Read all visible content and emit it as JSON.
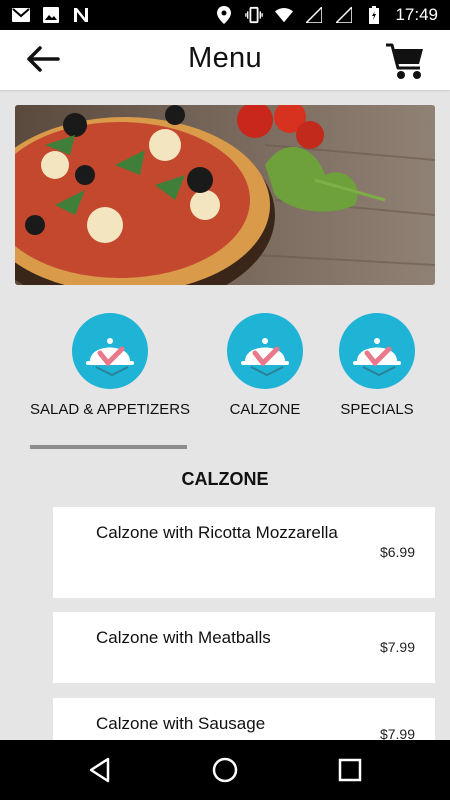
{
  "status_bar": {
    "time": "17:49",
    "icons": [
      "gmail-icon",
      "image-icon",
      "n-icon",
      "location-icon",
      "vibrate-icon",
      "wifi-icon",
      "signal-icon",
      "signal-icon-2",
      "battery-icon"
    ]
  },
  "app_bar": {
    "title": "Menu",
    "back_icon": "arrow-left-icon",
    "cart_icon": "shopping-cart-icon"
  },
  "categories": [
    {
      "label": "SALAD & APPETIZERS",
      "icon": "cloche-icon"
    },
    {
      "label": "CALZONE",
      "icon": "cloche-icon"
    },
    {
      "label": "SPECIALS",
      "icon": "cloche-icon"
    }
  ],
  "section": {
    "title": "CALZONE"
  },
  "items": [
    {
      "name": "Calzone with Ricotta Mozzarella",
      "price": "$6.99"
    },
    {
      "name": "Calzone with Meatballs",
      "price": "$7.99"
    },
    {
      "name": "Calzone with Sausage",
      "price": "$7.99"
    }
  ],
  "colors": {
    "accent": "#1fb3d6",
    "background": "#e5e5e5",
    "indicator": "#8c8c8c"
  }
}
